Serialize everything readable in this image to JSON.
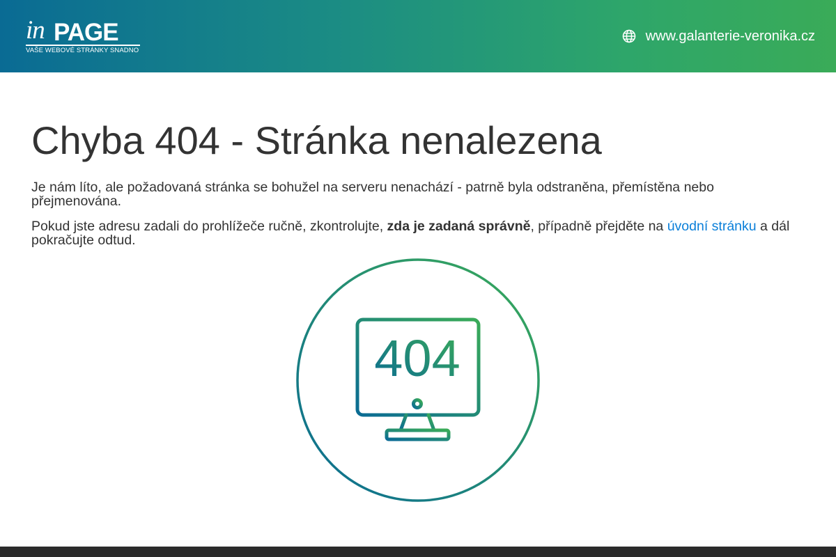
{
  "header": {
    "logo": {
      "word_in": "in",
      "word_page": "PAGE",
      "tagline": "VAŠE WEBOVÉ STRÁNKY SNADNO"
    },
    "domain": "www.galanterie-veronika.cz",
    "domain_icon": "globe-icon"
  },
  "main": {
    "title": "Chyba 404 - Stránka nenalezena",
    "paragraph1": "Je nám líto, ale požadovaná stránka se bohužel na serveru nenachází - patrně byla odstraněna, přemístěna nebo přejmenována.",
    "paragraph2": {
      "part1": "Pokud jste adresu zadali do prohlížeče ručně, zkontrolujte, ",
      "bold": "zda je zadaná správně",
      "part2": ", případně přejděte na ",
      "link": "úvodní stránku",
      "part3": " a dál pokračujte odtud."
    },
    "illustration": {
      "icon": "monitor-icon",
      "code": "404"
    }
  },
  "colors": {
    "gradient_start": "#0a6b94",
    "gradient_end": "#3aab58",
    "link": "#0a7fd9",
    "text": "#333333",
    "footer": "#2b2b2b"
  }
}
